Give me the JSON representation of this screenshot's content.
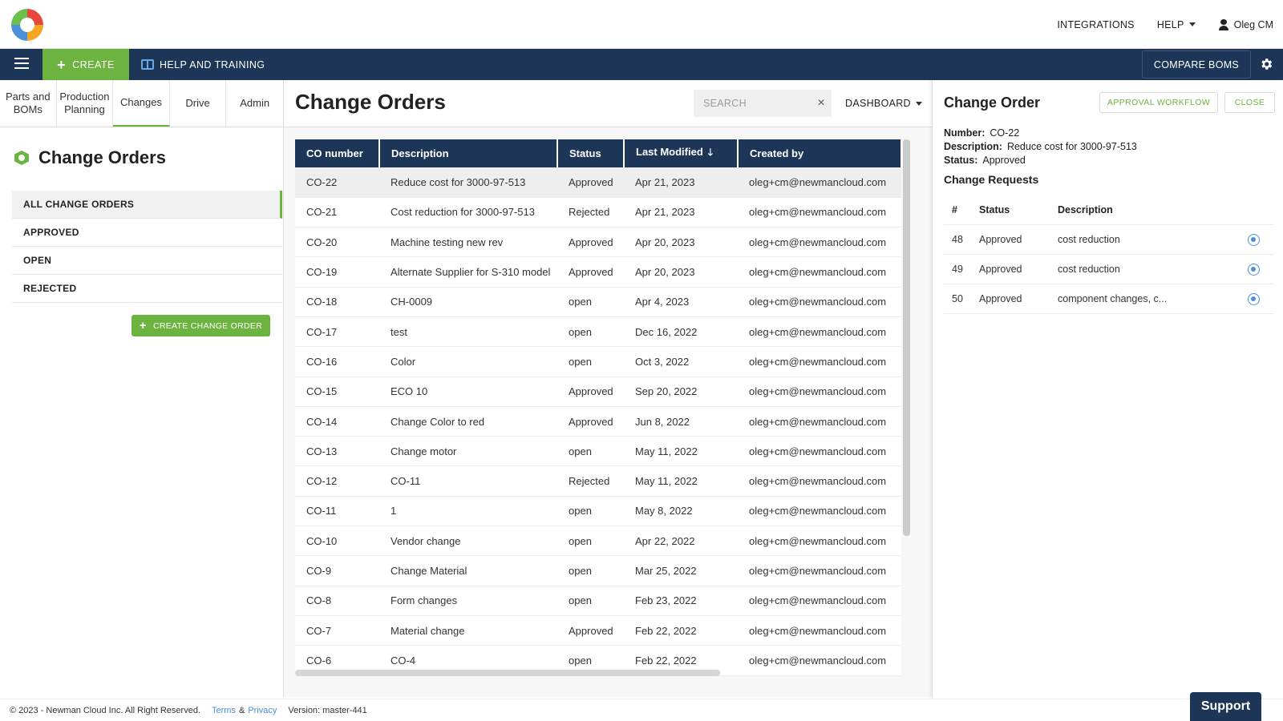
{
  "header": {
    "integrations": "INTEGRATIONS",
    "help": "HELP",
    "user": "Oleg CM"
  },
  "navbar": {
    "create": "CREATE",
    "help_training": "HELP AND TRAINING",
    "compare_boms": "COMPARE BOMS"
  },
  "tabs": [
    {
      "label": "Parts and BOMs"
    },
    {
      "label": "Production Planning"
    },
    {
      "label": "Changes"
    },
    {
      "label": "Drive"
    },
    {
      "label": "Admin"
    }
  ],
  "sidebar": {
    "title": "Change Orders",
    "filters": [
      "ALL CHANGE ORDERS",
      "APPROVED",
      "OPEN",
      "REJECTED"
    ],
    "create_button": "CREATE CHANGE ORDER"
  },
  "main": {
    "title": "Change Orders",
    "search_placeholder": "SEARCH",
    "dashboard": "DASHBOARD",
    "columns": [
      "CO number",
      "Description",
      "Status",
      "Last Modified",
      "Created by"
    ],
    "rows": [
      [
        "CO-22",
        "Reduce cost for 3000-97-513",
        "Approved",
        "Apr 21, 2023",
        "oleg+cm@newmancloud.com"
      ],
      [
        "CO-21",
        "Cost reduction for 3000-97-513",
        "Rejected",
        "Apr 21, 2023",
        "oleg+cm@newmancloud.com"
      ],
      [
        "CO-20",
        "Machine testing new rev",
        "Approved",
        "Apr 20, 2023",
        "oleg+cm@newmancloud.com"
      ],
      [
        "CO-19",
        "Alternate Supplier for S-310 model",
        "Approved",
        "Apr 20, 2023",
        "oleg+cm@newmancloud.com"
      ],
      [
        "CO-18",
        "CH-0009",
        "open",
        "Apr 4, 2023",
        "oleg+cm@newmancloud.com"
      ],
      [
        "CO-17",
        "test",
        "open",
        "Dec 16, 2022",
        "oleg+cm@newmancloud.com"
      ],
      [
        "CO-16",
        "Color",
        "open",
        "Oct 3, 2022",
        "oleg+cm@newmancloud.com"
      ],
      [
        "CO-15",
        "ECO 10",
        "Approved",
        "Sep 20, 2022",
        "oleg+cm@newmancloud.com"
      ],
      [
        "CO-14",
        "Change Color to red",
        "Approved",
        "Jun 8, 2022",
        "oleg+cm@newmancloud.com"
      ],
      [
        "CO-13",
        "Change motor",
        "open",
        "May 11, 2022",
        "oleg+cm@newmancloud.com"
      ],
      [
        "CO-12",
        "CO-11",
        "Rejected",
        "May 11, 2022",
        "oleg+cm@newmancloud.com"
      ],
      [
        "CO-11",
        "1",
        "open",
        "May 8, 2022",
        "oleg+cm@newmancloud.com"
      ],
      [
        "CO-10",
        "Vendor change",
        "open",
        "Apr 22, 2022",
        "oleg+cm@newmancloud.com"
      ],
      [
        "CO-9",
        "Change Material",
        "open",
        "Mar 25, 2022",
        "oleg+cm@newmancloud.com"
      ],
      [
        "CO-8",
        "Form changes",
        "open",
        "Feb 23, 2022",
        "oleg+cm@newmancloud.com"
      ],
      [
        "CO-7",
        "Material change",
        "Approved",
        "Feb 22, 2022",
        "oleg+cm@newmancloud.com"
      ],
      [
        "CO-6",
        "CO-4",
        "open",
        "Feb 22, 2022",
        "oleg+cm@newmancloud.com"
      ]
    ]
  },
  "detail": {
    "title": "Change Order",
    "approval_workflow": "APPROVAL WORKFLOW",
    "close": "CLOSE",
    "number_label": "Number:",
    "number": "CO-22",
    "description_label": "Description:",
    "description": "Reduce cost for 3000-97-513",
    "status_label": "Status:",
    "status": "Approved",
    "requests_title": "Change Requests",
    "requests_columns": [
      "#",
      "Status",
      "Description"
    ],
    "requests": [
      [
        "48",
        "Approved",
        "cost reduction"
      ],
      [
        "49",
        "Approved",
        "cost reduction"
      ],
      [
        "50",
        "Approved",
        "component changes, c..."
      ]
    ]
  },
  "footer": {
    "copyright": "© 2023 - Newman Cloud Inc. All Right Reserved.",
    "terms": "Terms",
    "amp": "&",
    "privacy": "Privacy",
    "version": "Version: master-441"
  },
  "support": "Support",
  "colors": {
    "navy": "#1d3557",
    "green": "#6db33f",
    "link_blue": "#4a90d9"
  }
}
